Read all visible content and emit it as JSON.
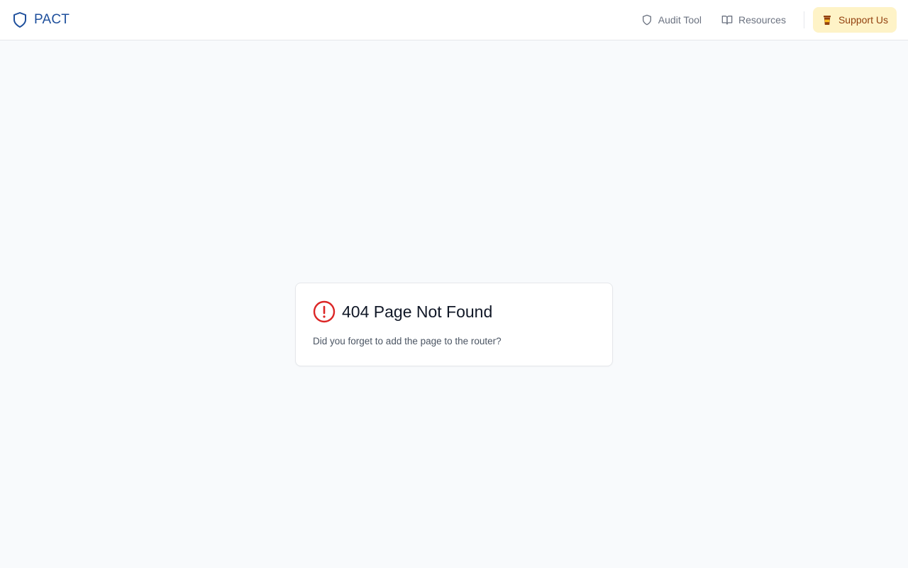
{
  "header": {
    "brand": {
      "label": "PACT",
      "icon": "shield-icon",
      "color": "#1e4f9c"
    },
    "nav": [
      {
        "label": "Audit Tool",
        "icon": "shield-icon"
      },
      {
        "label": "Resources",
        "icon": "book-open-icon"
      }
    ],
    "support": {
      "label": "Support Us",
      "icon": "coffee-cup-icon",
      "background": "#fef3c7",
      "text_color": "#92400e"
    }
  },
  "not_found": {
    "title": "404 Page Not Found",
    "message": "Did you forget to add the page to the router?",
    "icon": "alert-circle-icon",
    "icon_color": "#dc2626"
  }
}
